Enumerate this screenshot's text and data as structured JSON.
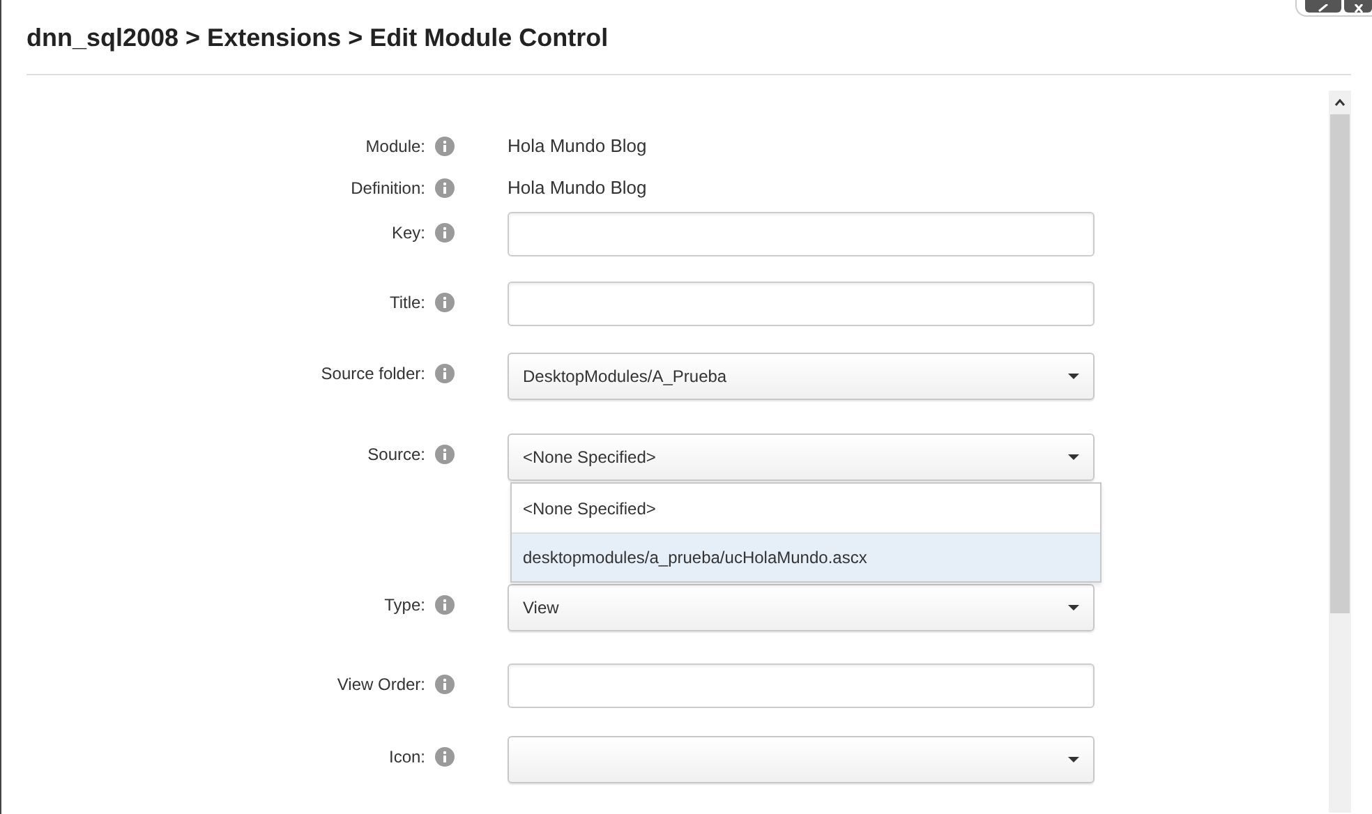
{
  "window": {
    "title": "dnn_sql2008 > Extensions > Edit Module Control"
  },
  "fields": [
    {
      "label": "Module:",
      "kind": "text",
      "value": "Hola Mundo Blog"
    },
    {
      "label": "Definition:",
      "kind": "text",
      "value": "Hola Mundo Blog"
    },
    {
      "label": "Key:",
      "kind": "input"
    },
    {
      "label": "Title:",
      "kind": "input"
    },
    {
      "label": "Source folder:",
      "kind": "select",
      "value": "DesktopModules/A_Prueba"
    },
    {
      "label": "Source:",
      "kind": "select",
      "value": "<None Specified>",
      "expanded": true,
      "options": [
        {
          "label": "<None Specified>",
          "highlighted": false
        },
        {
          "label": "desktopmodules/a_prueba/ucHolaMundo.ascx",
          "highlighted": true
        }
      ]
    },
    {
      "label": "Type:",
      "kind": "select",
      "value": "View"
    },
    {
      "label": "View Order:",
      "kind": "input"
    },
    {
      "label": "Icon:",
      "kind": "select"
    }
  ]
}
